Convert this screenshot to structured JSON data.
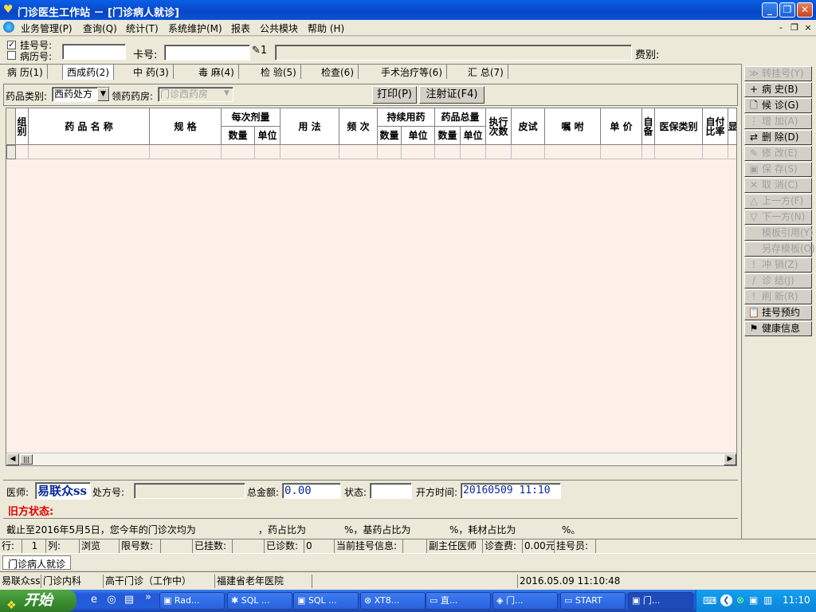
{
  "window": {
    "title": "门诊医生工作站 － [门诊病人就诊]",
    "minimize": "_",
    "maximize": "❐",
    "close": "✕"
  },
  "menu": {
    "items": [
      "业务管理(P)",
      "查询(Q)",
      "统计(T)",
      "系统维护(M)",
      "报表",
      "公共模块",
      "帮助 (H)"
    ],
    "mdi_min": "-",
    "mdi_restore": "❐",
    "mdi_close": "×"
  },
  "header": {
    "reg_label": "挂号号:",
    "record_label": "病历号:",
    "reg_checked": "✓",
    "card_label": "卡号:",
    "fee_label": "费别:",
    "btn_suffix": "1"
  },
  "tabs": [
    {
      "label": "病 历(1)"
    },
    {
      "label": "西成药(2)"
    },
    {
      "label": "中 药(3)"
    },
    {
      "label": "毒 麻(4)"
    },
    {
      "label": "检 验(5)"
    },
    {
      "label": "检查(6)"
    },
    {
      "label": "手术治疗等(6)"
    },
    {
      "label": "汇 总(7)"
    }
  ],
  "toolbar": {
    "drug_type_label": "药品类别:",
    "drug_type_value": "西药处方",
    "pharmacy_label": "领药药房:",
    "pharmacy_value": "门诊西药房",
    "print_button": "打印(P)",
    "inject_button": "注射证(F4)"
  },
  "grid": {
    "headers": {
      "group": "组别",
      "drug_name": "药 品 名 称",
      "spec": "规 格",
      "dose": "每次剂量",
      "dose_qty": "数量",
      "dose_unit": "单位",
      "usage": "用 法",
      "freq": "频 次",
      "cont": "持续用药",
      "cont_qty": "数量",
      "cont_unit": "单位",
      "total": "药品总量",
      "total_qty": "数量",
      "total_unit": "单位",
      "exec": "执行次数",
      "skin": "皮试",
      "note": "嘱 咐",
      "price": "单 价",
      "self": "自备",
      "insurance": "医保类别",
      "ratio": "自付比率",
      "more": "显"
    }
  },
  "side_buttons": [
    {
      "label": "转挂号(Y)",
      "icon": "≫",
      "enabled": false
    },
    {
      "label": "病 史(B)",
      "icon": "+",
      "enabled": true
    },
    {
      "label": "候 诊(G)",
      "icon": "🗋",
      "enabled": true
    },
    {
      "label": "增 加(A)",
      "icon": "⋮",
      "enabled": false
    },
    {
      "label": "删 除(D)",
      "icon": "⇄",
      "enabled": true
    },
    {
      "label": "修 改(E)",
      "icon": "✎",
      "enabled": false
    },
    {
      "label": "保 存(S)",
      "icon": "▣",
      "enabled": false
    },
    {
      "label": "取 消(C)",
      "icon": "✕",
      "enabled": false
    },
    {
      "label": "上一方(F)",
      "icon": "△",
      "enabled": false
    },
    {
      "label": "下一方(N)",
      "icon": "▽",
      "enabled": false
    },
    {
      "label": "模板引用(Y)",
      "icon": "",
      "enabled": false
    },
    {
      "label": "另存模板(O)",
      "icon": "",
      "enabled": false
    },
    {
      "label": "冲 销(Z)",
      "icon": "!",
      "enabled": false
    },
    {
      "label": "诊 结(J)",
      "icon": "/",
      "enabled": false
    },
    {
      "label": "刷 新(R)",
      "icon": "!",
      "enabled": false
    },
    {
      "label": "挂号预约",
      "icon": "📋",
      "enabled": true
    },
    {
      "label": "健康信息",
      "icon": "⚑",
      "enabled": true
    }
  ],
  "footer": {
    "doctor_label": "医师:",
    "doctor_value": "易联众ss",
    "rx_label": "处方号:",
    "total_label": "总金额:",
    "total_value": "0.00",
    "status_label": "状态:",
    "time_label": "开方时间:",
    "time_value": "20160509 11:10",
    "old_status": "旧方状态:",
    "stats_prefix": "截止至2016年5月5日，您今年的门诊次均为",
    "stats_drug": "，药占比为",
    "stats_base": "%，基药占比为",
    "stats_mat": "%，耗材占比为",
    "stats_end": "%。"
  },
  "statusbar1": {
    "row_label": "行:",
    "row_value": "1",
    "col_label": "列:",
    "mode": "浏览",
    "limit_label": "限号数:",
    "registered_label": "已挂数:",
    "seen_label": "已诊数:",
    "seen_value": "0",
    "current_label": "当前挂号信息:",
    "title_value": "副主任医师",
    "fee_label": "诊查费:",
    "fee_value": "0.00元",
    "registrar_label": "挂号员:"
  },
  "mdi_tab": "门诊病人就诊",
  "statusbar2": {
    "user": "易联众ss",
    "dept": "门诊内科",
    "station": "高干门诊（工作中）",
    "hospital": "福建省老年医院",
    "datetime": "2016.05.09 11:10:48"
  },
  "taskbar": {
    "start": "开始",
    "tasks": [
      "Rad...",
      "SQL ...",
      "SQL ...",
      "XT8...",
      "直...",
      "门...",
      "START",
      "门..."
    ],
    "clock": "11:10",
    "chevron": "»"
  }
}
